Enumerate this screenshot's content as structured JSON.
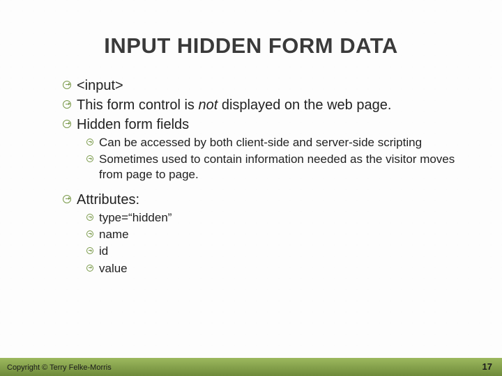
{
  "title": "INPUT HIDDEN FORM DATA",
  "bullets": {
    "b1": "<input>",
    "b2_pre": "This form control is ",
    "b2_em": "not",
    "b2_post": " displayed on the web page.",
    "b3": "Hidden form fields",
    "b3_sub1": "Can be accessed by both client-side and server-side scripting",
    "b3_sub2": "Sometimes used to contain information needed as the visitor moves from page to page.",
    "b4": "Attributes:",
    "b4_sub1": "type=“hidden”",
    "b4_sub2": "name",
    "b4_sub3": "id",
    "b4_sub4": "value"
  },
  "footer": {
    "copyright": "Copyright © Terry Felke-Morris",
    "page": "17"
  }
}
